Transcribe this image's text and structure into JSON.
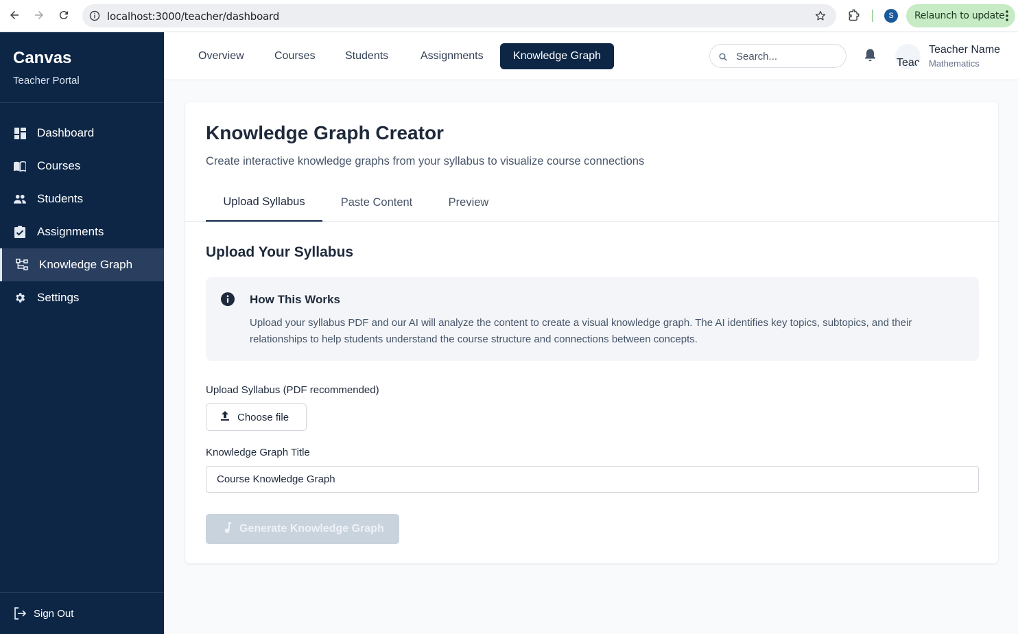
{
  "browser": {
    "url": "localhost:3000/teacher/dashboard",
    "profile_initial": "S",
    "relaunch_label": "Relaunch to update"
  },
  "sidebar": {
    "brand": "Canvas",
    "subtitle": "Teacher Portal",
    "items": [
      {
        "label": "Dashboard",
        "icon": "dashboard-icon"
      },
      {
        "label": "Courses",
        "icon": "book-icon"
      },
      {
        "label": "Students",
        "icon": "people-icon"
      },
      {
        "label": "Assignments",
        "icon": "clipboard-check-icon"
      },
      {
        "label": "Knowledge Graph",
        "icon": "graph-icon",
        "active": true
      },
      {
        "label": "Settings",
        "icon": "gear-icon"
      }
    ],
    "signout": "Sign Out"
  },
  "topnav": {
    "items": [
      "Overview",
      "Courses",
      "Students",
      "Assignments",
      "Knowledge Graph"
    ],
    "active": "Knowledge Graph",
    "search_placeholder": "Search...",
    "avatar_alt": "Teac",
    "user_name": "Teacher Name",
    "user_role": "Mathematics"
  },
  "main": {
    "title": "Knowledge Graph Creator",
    "description": "Create interactive knowledge graphs from your syllabus to visualize course connections",
    "tabs": [
      "Upload Syllabus",
      "Paste Content",
      "Preview"
    ],
    "active_tab": "Upload Syllabus",
    "section_title": "Upload Your Syllabus",
    "info": {
      "title": "How This Works",
      "text": "Upload your syllabus PDF and our AI will analyze the content to create a visual knowledge graph. The AI identifies key topics, subtopics, and their relationships to help students understand the course structure and connections between concepts."
    },
    "upload_label": "Upload Syllabus (PDF recommended)",
    "choose_file": "Choose file",
    "graph_title_label": "Knowledge Graph Title",
    "graph_title_value": "Course Knowledge Graph",
    "generate_label": "Generate Knowledge Graph"
  },
  "colors": {
    "sidebar_bg": "#0d2646",
    "accent": "#0d2646",
    "disabled_button": "#c9d3de",
    "relaunch_bg": "#c6ebc5"
  }
}
